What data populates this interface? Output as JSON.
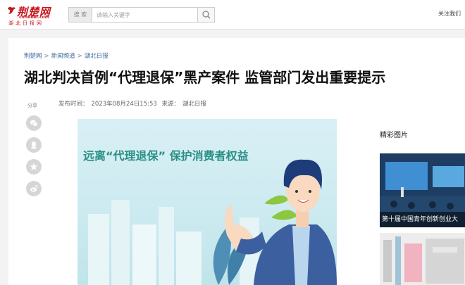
{
  "header": {
    "logo_text": "荆楚网",
    "logo_sub": "cnhubei.com",
    "logo_tag": "湖北日报网",
    "search": {
      "category": "搜 索",
      "placeholder": "请输入关键字"
    },
    "follow_label": "关注我们"
  },
  "breadcrumb": [
    "荆楚网",
    "新闻频道",
    "湖北日报"
  ],
  "article": {
    "title": "湖北判决首例“代理退保”黑产案件 监管部门发出重要提示",
    "publish_label": "发布时间：",
    "publish_time": "2023年08月24日15:53",
    "source_label": "来源：",
    "source": "湖北日报",
    "hero_caption": "远离“代理退保” 保护消费者权益"
  },
  "share": {
    "label": "分享",
    "buttons": [
      "wechat-icon",
      "qq-icon",
      "favorite-icon",
      "weibo-icon"
    ]
  },
  "sidebar": {
    "title": "精彩图片",
    "pictures": [
      {
        "caption": "第十届中国青年创新创业大"
      },
      {
        "caption": ""
      }
    ]
  },
  "colors": {
    "brand_red": "#c8161d",
    "link_blue": "#436ea3",
    "hero_teal": "#2a8f85"
  }
}
